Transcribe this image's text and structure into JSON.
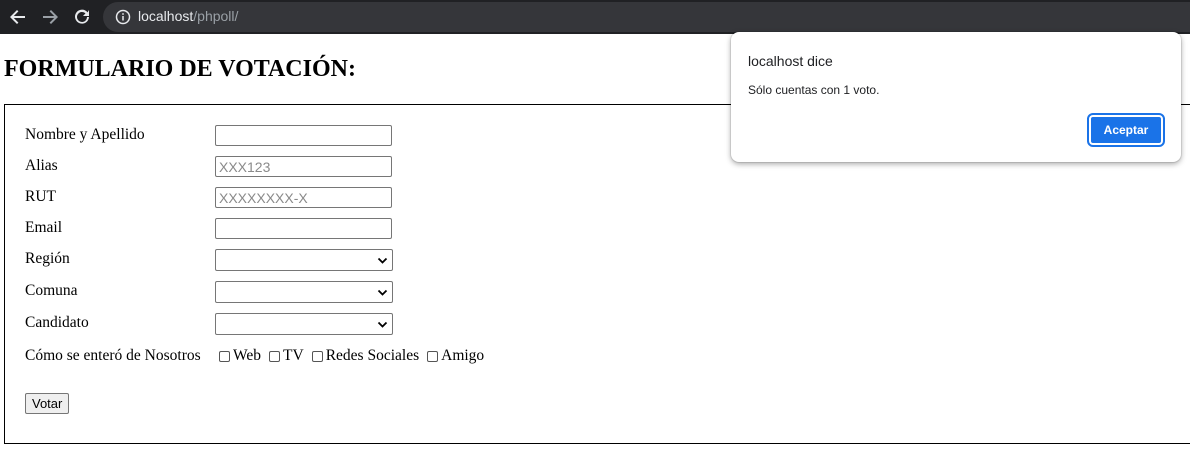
{
  "browser": {
    "url_host": "localhost",
    "url_path": "/phpoll/",
    "icons": [
      "back-arrow-icon",
      "forward-arrow-icon",
      "reload-icon",
      "info-icon"
    ]
  },
  "page": {
    "title": "FORMULARIO DE VOTACIÓN:"
  },
  "form": {
    "fields": {
      "nombre": {
        "label": "Nombre y Apellido",
        "value": "",
        "placeholder": ""
      },
      "alias": {
        "label": "Alias",
        "value": "",
        "placeholder": "XXX123"
      },
      "rut": {
        "label": "RUT",
        "value": "",
        "placeholder": "XXXXXXXX-X"
      },
      "email": {
        "label": "Email",
        "value": "",
        "placeholder": ""
      },
      "region": {
        "label": "Región",
        "selected": ""
      },
      "comuna": {
        "label": "Comuna",
        "selected": ""
      },
      "candidato": {
        "label": "Candidato",
        "selected": ""
      }
    },
    "source": {
      "label": "Cómo se enteró de Nosotros",
      "options": [
        "Web",
        "TV",
        "Redes Sociales",
        "Amigo"
      ]
    },
    "submit_label": "Votar"
  },
  "dialog": {
    "title": "localhost dice",
    "message": "Sólo cuentas con 1 voto.",
    "button_label": "Aceptar",
    "accent": "#1a73e8"
  }
}
